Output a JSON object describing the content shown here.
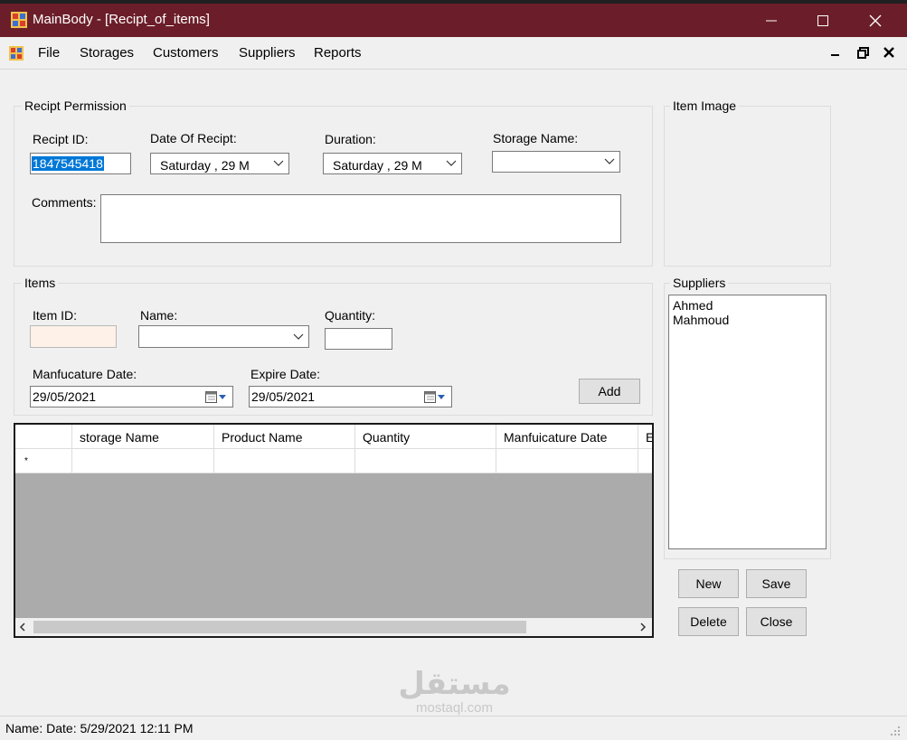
{
  "window": {
    "title": "MainBody - [Recipt_of_items]"
  },
  "menu": [
    "File",
    "Storages",
    "Customers",
    "Suppliers",
    "Reports"
  ],
  "recipt_permission": {
    "group_title": "Recipt Permission",
    "recipt_id_label": "Recipt ID:",
    "recipt_id_value": "1847545418",
    "date_label": "Date Of Recipt:",
    "date_value": "Saturday  , 29    M",
    "duration_label": "Duration:",
    "duration_value": "Saturday  , 29    M",
    "storage_label": "Storage Name:",
    "storage_value": "",
    "comments_label": "Comments:",
    "comments_value": ""
  },
  "item_image": {
    "group_title": "Item Image"
  },
  "items": {
    "group_title": "Items",
    "item_id_label": "Item ID:",
    "item_id_value": "",
    "name_label": "Name:",
    "name_value": "",
    "quantity_label": "Quantity:",
    "quantity_value": "",
    "manufacture_label": "Manfucature Date:",
    "manufacture_value": "29/05/2021",
    "expire_label": "Expire Date:",
    "expire_value": "29/05/2021",
    "add_button": "Add"
  },
  "grid": {
    "columns": [
      "storage Name",
      "Product Name",
      "Quantity",
      "Manfuicature Date",
      "E"
    ],
    "new_row_marker": "*"
  },
  "suppliers": {
    "group_title": "Suppliers",
    "items": [
      "Ahmed",
      "Mahmoud"
    ]
  },
  "actions": {
    "new": "New",
    "save": "Save",
    "delete": "Delete",
    "close": "Close"
  },
  "status": {
    "text": "Name:  Date:  5/29/2021 12:11 PM"
  },
  "watermark": {
    "arabic": "مستقل",
    "latin": "mostaql.com"
  },
  "colors": {
    "titlebar": "#6b1e29",
    "selection": "#0078d7",
    "item_id_bg": "#fdf1e8",
    "grid_background": "#ababab"
  },
  "icons": [
    "app-icon",
    "minimize-icon",
    "maximize-icon",
    "close-icon",
    "calendar-icon",
    "chevron-down-icon"
  ]
}
